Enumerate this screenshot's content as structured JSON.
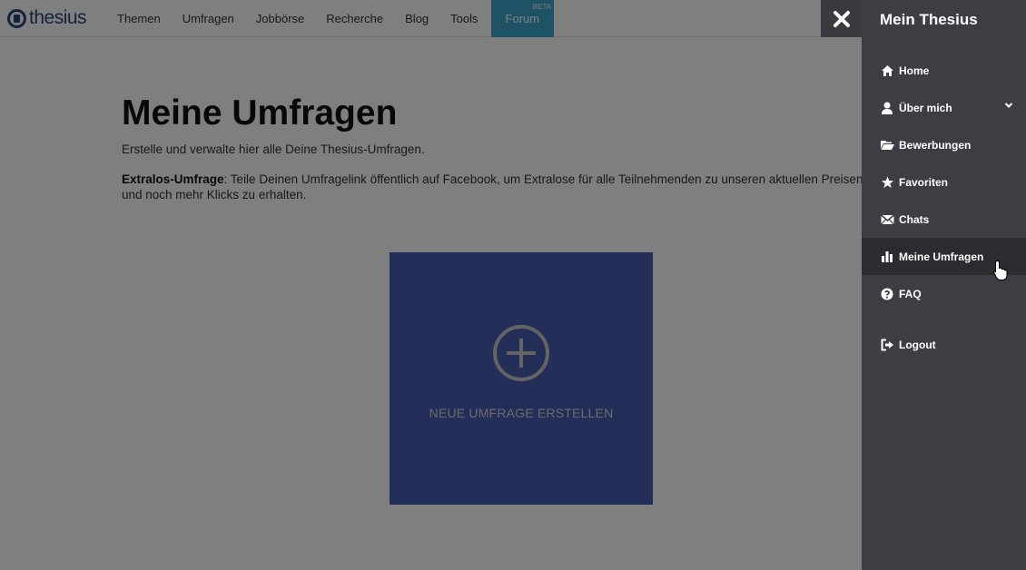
{
  "header": {
    "logo_text": "thesius",
    "nav": [
      {
        "label": "Themen"
      },
      {
        "label": "Umfragen"
      },
      {
        "label": "Jobbörse"
      },
      {
        "label": "Recherche"
      },
      {
        "label": "Blog"
      },
      {
        "label": "Tools"
      },
      {
        "label": "Forum",
        "badge": "BETA"
      }
    ]
  },
  "main": {
    "title": "Meine Umfragen",
    "intro": "Erstelle und verwalte hier alle Deine Thesius-Umfragen.",
    "extra_bold": "Extralos-Umfrage",
    "extra_text": ": Teile Deinen Umfragelink öffentlich auf Facebook, um Extralose für alle Teilnehmenden zu unseren aktuellen Preisen und noch mehr Klicks zu erhalten.",
    "new_survey_label": "NEUE UMFRAGE ERSTELLEN"
  },
  "drawer": {
    "title": "Mein Thesius",
    "items": [
      {
        "label": "Home",
        "icon": "home-icon"
      },
      {
        "label": "Über mich",
        "icon": "user-icon"
      },
      {
        "label": "Bewerbungen",
        "icon": "folder-open-icon"
      },
      {
        "label": "Favoriten",
        "icon": "star-icon"
      },
      {
        "label": "Chats",
        "icon": "envelope-icon"
      },
      {
        "label": "Meine Umfragen",
        "icon": "bar-chart-icon",
        "active": true
      },
      {
        "label": "FAQ",
        "icon": "question-circle-icon"
      },
      {
        "label": "Logout",
        "icon": "sign-out-icon"
      }
    ]
  },
  "colors": {
    "drawer_bg": "#3d3d43",
    "drawer_active_bg": "#2b2b30",
    "card_bg": "#475fb0",
    "forum_bg": "#3ba7c9",
    "brand": "#27447a"
  }
}
